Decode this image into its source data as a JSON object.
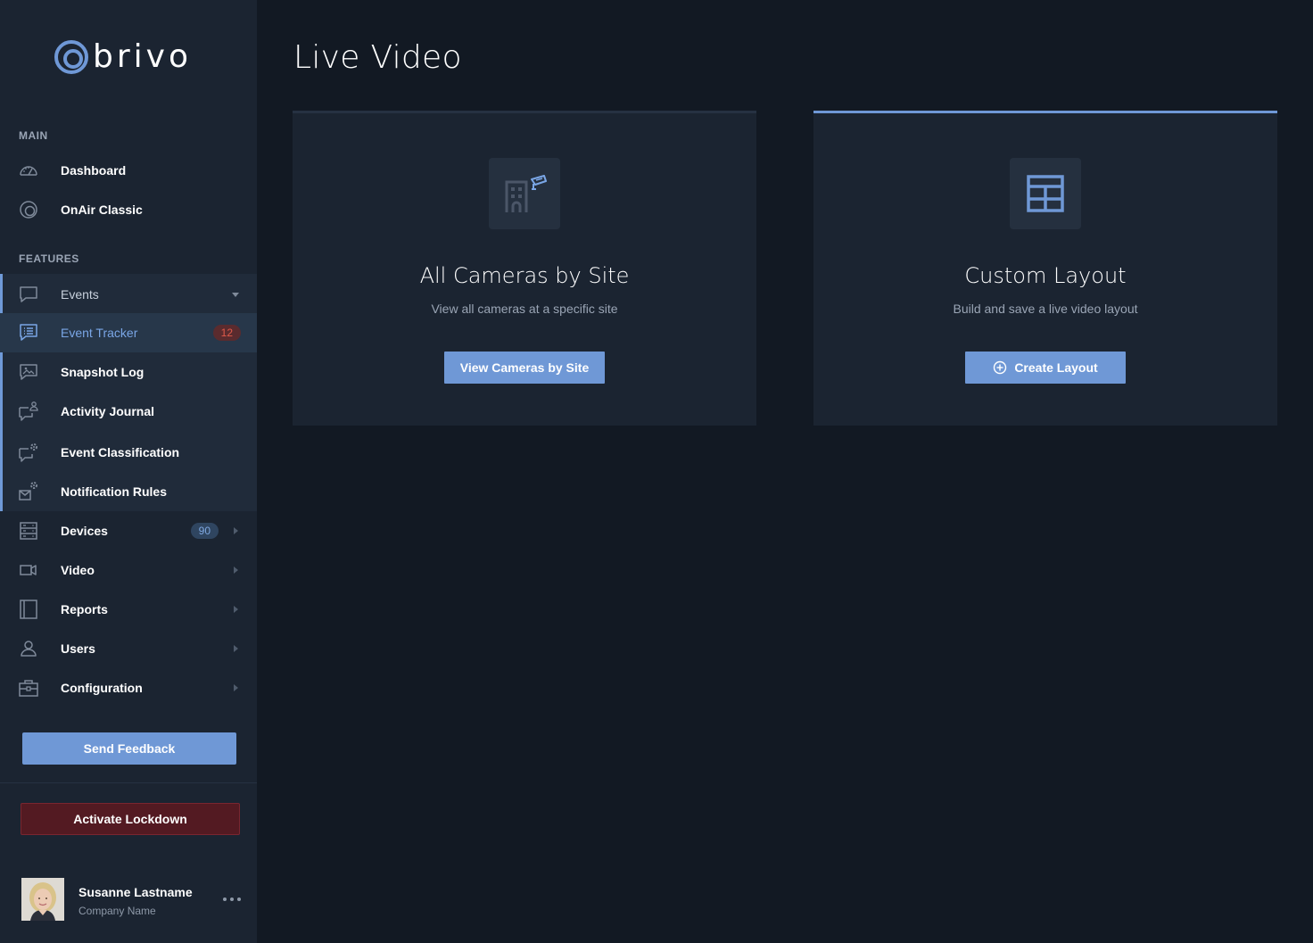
{
  "brand": {
    "name": "brivo"
  },
  "sidebar": {
    "main_label": "MAIN",
    "features_label": "FEATURES",
    "main_items": [
      {
        "label": "Dashboard",
        "icon": "speedometer-icon"
      },
      {
        "label": "OnAir Classic",
        "icon": "onair-icon"
      }
    ],
    "features_items": [
      {
        "label": "Events",
        "icon": "chat-icon"
      },
      {
        "label": "Event Tracker",
        "icon": "list-icon",
        "badge": "12"
      },
      {
        "label": "Snapshot Log",
        "icon": "image-icon"
      },
      {
        "label": "Activity Journal",
        "icon": "chat-user-icon"
      },
      {
        "label": "Event Classification",
        "icon": "chat-gear-icon"
      },
      {
        "label": "Notification Rules",
        "icon": "mail-gear-icon"
      },
      {
        "label": "Devices",
        "icon": "server-icon",
        "badge": "90"
      },
      {
        "label": "Video",
        "icon": "video-icon"
      },
      {
        "label": "Reports",
        "icon": "book-icon"
      },
      {
        "label": "Users",
        "icon": "user-icon"
      },
      {
        "label": "Configuration",
        "icon": "toolbox-icon"
      }
    ],
    "send_feedback": "Send Feedback",
    "activate_lockdown": "Activate Lockdown",
    "user": {
      "name": "Susanne Lastname",
      "company": "Company Name"
    }
  },
  "main": {
    "title": "Live Video",
    "cards": [
      {
        "title": "All Cameras by Site",
        "description": "View all cameras at a specific site",
        "button": "View Cameras by Site",
        "icon": "building-camera-icon"
      },
      {
        "title": "Custom Layout",
        "description": "Build and save a live video layout",
        "button": "Create Layout",
        "icon": "grid-layout-icon"
      }
    ]
  },
  "colors": {
    "accent": "#6f98d6",
    "sidebar_bg": "#1b2431",
    "page_bg": "#121923",
    "lockdown": "#531a22",
    "badge_red": "#e05a4a"
  }
}
